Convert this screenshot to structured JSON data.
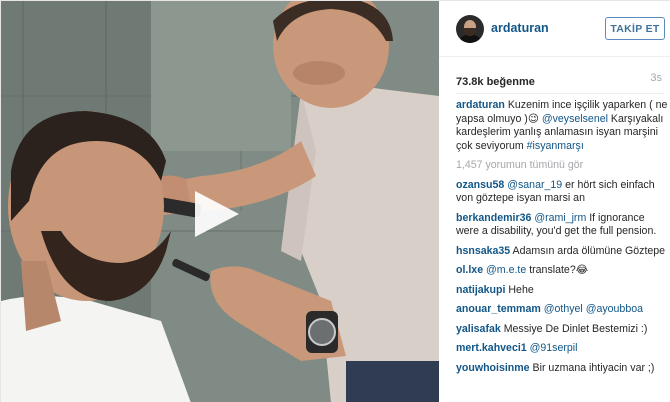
{
  "post": {
    "username": "ardaturan",
    "follow_label": "TAKİP ET",
    "likes": "73.8k beğenme",
    "time": "3s",
    "media_play_icon": "play-icon"
  },
  "caption": {
    "user": "ardaturan",
    "text1": " Kuzenim ince işçilik yaparken ( ne yapsa olmuyo )",
    "emoji": "😉",
    "mention": "@veyselsenel",
    "text2": " Karşıyakalı kardeşlerim yanlış anlamasın isyan marşini çok seviyorum ",
    "hashtag": "#isyanmarşı"
  },
  "view_all": "1,457 yorumun tümünü gör",
  "comments": [
    {
      "user": "ozansu58",
      "mention": "@sanar_19",
      "text": " er hört sich einfach von göztepe isyan marsi an"
    },
    {
      "user": "berkandemir36",
      "mention": "@rami_jrm",
      "text": " If ignorance were a disability, you'd get the full pension."
    },
    {
      "user": "hsnsaka35",
      "mention": "",
      "text": "Adamsın arda ölümüne Göztepe"
    },
    {
      "user": "ol.lxe",
      "mention": "@m.e.te",
      "text": " translate?😂"
    },
    {
      "user": "natijakupi",
      "mention": "",
      "text": "Hehe"
    },
    {
      "user": "anouar_temmam",
      "mention": "@othyel @ayoubboa",
      "text": ""
    },
    {
      "user": "yalisafak",
      "mention": "",
      "text": "Messiye De Dinlet Bestemizi :)"
    },
    {
      "user": "mert.kahveci1",
      "mention": "@91serpil",
      "text": ""
    },
    {
      "user": "youwhoisinme",
      "mention": "",
      "text": "Bir uzmana ihtiyacin var ;)"
    }
  ],
  "colors": {
    "link": "#125688",
    "muted": "#a5a7aa",
    "follow_border": "#5b8bbd"
  }
}
